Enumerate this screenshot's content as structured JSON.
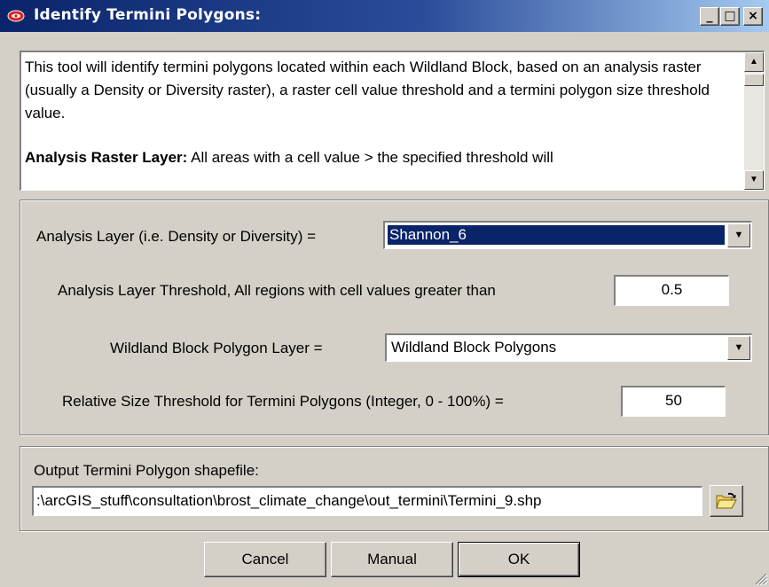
{
  "window": {
    "title": "Identify Termini Polygons:",
    "icon": "esri-red-eye-icon",
    "controls": {
      "minimize": "_",
      "maximize": "□",
      "close": "×"
    }
  },
  "help": {
    "paragraph1": "This tool will identify termini polygons located within each Wildland Block, based on an analysis raster (usually a Density or Diversity raster), a raster cell value threshold and a termini polygon size threshold value.",
    "paragraph2_bold": "Analysis Raster Layer:",
    "paragraph2_rest": "  All areas with a cell value > the specified threshold will"
  },
  "form": {
    "analysis_layer": {
      "label": "Analysis Layer (i.e. Density or Diversity) =",
      "value": "Shannon_6"
    },
    "threshold": {
      "label": "Analysis Layer Threshold, All regions with cell values greater than",
      "value": "0.5"
    },
    "wildland_block": {
      "label": "Wildland Block Polygon Layer =",
      "value": "Wildland Block Polygons"
    },
    "size_threshold": {
      "label": "Relative Size Threshold for Termini Polygons (Integer, 0 - 100%) =",
      "value": "50"
    }
  },
  "output": {
    "label": "Output Termini Polygon shapefile:",
    "value": ":\\arcGIS_stuff\\consultation\\brost_climate_change\\out_termini\\Termini_9.shp",
    "browse_icon": "open-folder-icon"
  },
  "buttons": {
    "cancel": "Cancel",
    "manual": "Manual",
    "ok": "OK"
  },
  "colors": {
    "title_start": "#0a246a",
    "title_end": "#a6caf0",
    "face": "#d4d0c8",
    "selection": "#0a246a"
  }
}
